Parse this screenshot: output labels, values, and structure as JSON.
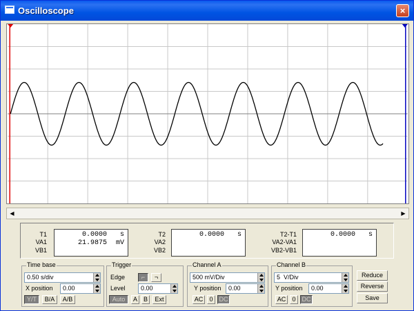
{
  "window": {
    "title": "Oscilloscope",
    "close_glyph": "×"
  },
  "display": {
    "cursor_t1_label": "1",
    "cursor_t2_label": "2",
    "trace_color": "#000000",
    "grid_color": "#C8C8C8",
    "cursor1_color": "#E00000",
    "cursor2_color": "#0000C0",
    "trace": {
      "cycles": 7.3,
      "amplitude_div": 1.4,
      "start_phase_div": 0
    }
  },
  "scrollbar": {
    "left_glyph": "◀",
    "right_glyph": "▶"
  },
  "readout": {
    "t1": {
      "label": "T1",
      "value": "0.0000",
      "unit": "s"
    },
    "va1": {
      "label": "VA1",
      "value": "21.9875",
      "unit": "mV"
    },
    "vb1": {
      "label": "VB1"
    },
    "t2": {
      "label": "T2",
      "value": "0.0000",
      "unit": "s"
    },
    "va2": {
      "label": "VA2"
    },
    "vb2": {
      "label": "VB2"
    },
    "t2t1": {
      "label": "T2-T1",
      "value": "0.0000",
      "unit": "s"
    },
    "va2va1": {
      "label": "VA2-VA1"
    },
    "vb2vb1": {
      "label": "VB2-VB1"
    }
  },
  "timebase": {
    "title": "Time base",
    "scale": "0.50 s/div",
    "xpos_label": "X position",
    "xpos_value": "0.00",
    "modes": [
      "Y/T",
      "B/A",
      "A/B"
    ],
    "active_mode": "Y/T"
  },
  "trigger": {
    "title": "Trigger",
    "edge_label": "Edge",
    "edge_rise_glyph": "⌐",
    "edge_fall_glyph": "¬",
    "level_label": "Level",
    "level_value": "0.00",
    "modes": [
      "Auto",
      "A",
      "B",
      "Ext"
    ],
    "active_mode": "Auto"
  },
  "channel_a": {
    "title": "Channel A",
    "scale": "500 mV/Div",
    "ypos_label": "Y position",
    "ypos_value": "0.00",
    "coupling": [
      "AC",
      "0",
      "DC"
    ],
    "active_coupling": "DC"
  },
  "channel_b": {
    "title": "Channel B",
    "scale": "5  V/Div",
    "ypos_label": "Y position",
    "ypos_value": "0.00",
    "coupling": [
      "AC",
      "0",
      "DC"
    ],
    "active_coupling": "DC"
  },
  "actions": {
    "reduce": "Reduce",
    "reverse": "Reverse",
    "save": "Save"
  }
}
